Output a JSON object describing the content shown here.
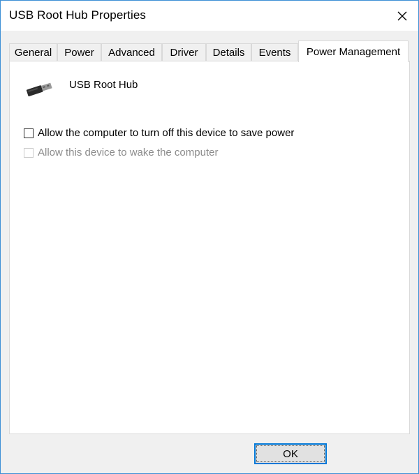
{
  "window": {
    "title": "USB Root Hub Properties"
  },
  "tabs": [
    {
      "label": "General",
      "active": false
    },
    {
      "label": "Power",
      "active": false
    },
    {
      "label": "Advanced",
      "active": false
    },
    {
      "label": "Driver",
      "active": false
    },
    {
      "label": "Details",
      "active": false
    },
    {
      "label": "Events",
      "active": false
    },
    {
      "label": "Power Management",
      "active": true
    }
  ],
  "panel": {
    "device_icon": "usb-connector-icon",
    "device_name": "USB Root Hub",
    "options": [
      {
        "label": "Allow the computer to turn off this device to save power",
        "checked": false,
        "enabled": true
      },
      {
        "label": "Allow this device to wake the computer",
        "checked": false,
        "enabled": false
      }
    ]
  },
  "buttons": {
    "ok_label": "OK"
  },
  "colors": {
    "accent": "#0078d7",
    "window_border": "#3c8fd6",
    "dialog_background": "#f0f0f0",
    "disabled_text": "#8c8c8c"
  }
}
